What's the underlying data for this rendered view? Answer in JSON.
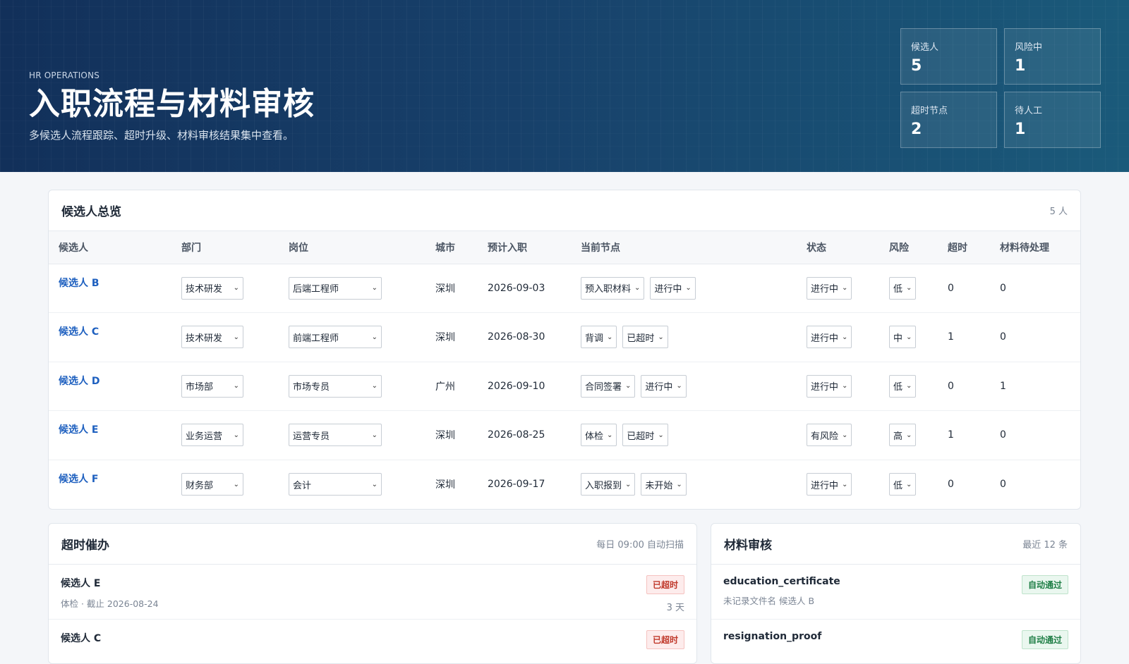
{
  "hero": {
    "eyebrow": "HR OPERATIONS",
    "title": "入职流程与材料审核",
    "subtitle": "多候选人流程跟踪、超时升级、材料审核结果集中查看。",
    "stats": [
      {
        "label": "候选人",
        "value": "5"
      },
      {
        "label": "风险中",
        "value": "1"
      },
      {
        "label": "超时节点",
        "value": "2"
      },
      {
        "label": "待人工",
        "value": "1"
      }
    ]
  },
  "overview": {
    "title": "候选人总览",
    "count": "5 人",
    "columns": [
      "候选人",
      "部门",
      "岗位",
      "城市",
      "预计入职",
      "当前节点",
      "状态",
      "风险",
      "超时",
      "材料待处理"
    ],
    "rows": [
      {
        "name": "候选人 B",
        "dept": "技术研发",
        "role": "后端工程师",
        "city": "深圳",
        "date": "2026-09-03",
        "node": "预入职材料",
        "node_status": "进行中",
        "status": "进行中",
        "risk": "低",
        "overdue": "0",
        "pending": "0"
      },
      {
        "name": "候选人 C",
        "dept": "技术研发",
        "role": "前端工程师",
        "city": "深圳",
        "date": "2026-08-30",
        "node": "背调",
        "node_status": "已超时",
        "status": "进行中",
        "risk": "中",
        "overdue": "1",
        "pending": "0"
      },
      {
        "name": "候选人 D",
        "dept": "市场部",
        "role": "市场专员",
        "city": "广州",
        "date": "2026-09-10",
        "node": "合同签署",
        "node_status": "进行中",
        "status": "进行中",
        "risk": "低",
        "overdue": "0",
        "pending": "1"
      },
      {
        "name": "候选人 E",
        "dept": "业务运营",
        "role": "运营专员",
        "city": "深圳",
        "date": "2026-08-25",
        "node": "体检",
        "node_status": "已超时",
        "status": "有风险",
        "risk": "高",
        "overdue": "1",
        "pending": "0"
      },
      {
        "name": "候选人 F",
        "dept": "财务部",
        "role": "会计",
        "city": "深圳",
        "date": "2026-09-17",
        "node": "入职报到",
        "node_status": "未开始",
        "status": "进行中",
        "risk": "低",
        "overdue": "0",
        "pending": "0"
      }
    ]
  },
  "overdue": {
    "title": "超时催办",
    "meta": "每日 09:00 自动扫描",
    "items": [
      {
        "name": "候选人 E",
        "sub": "体检 · 截止 2026-08-24",
        "badge": "已超时",
        "days": "3 天"
      },
      {
        "name": "候选人 C",
        "sub": "",
        "badge": "已超时",
        "days": ""
      }
    ]
  },
  "review": {
    "title": "材料审核",
    "meta": "最近 12 条",
    "items": [
      {
        "name": "education_certificate",
        "sub": "未记录文件名 候选人 B",
        "badge": "自动通过"
      },
      {
        "name": "resignation_proof",
        "sub": "",
        "badge": "自动通过"
      }
    ]
  },
  "colors": {
    "accent": "#1d5fbf",
    "hero_start": "#12305a",
    "hero_end": "#1a5a7a",
    "danger": "#c0392b",
    "success": "#1e7e45"
  },
  "icons": {
    "select_chevron": "chevron-down-icon"
  }
}
